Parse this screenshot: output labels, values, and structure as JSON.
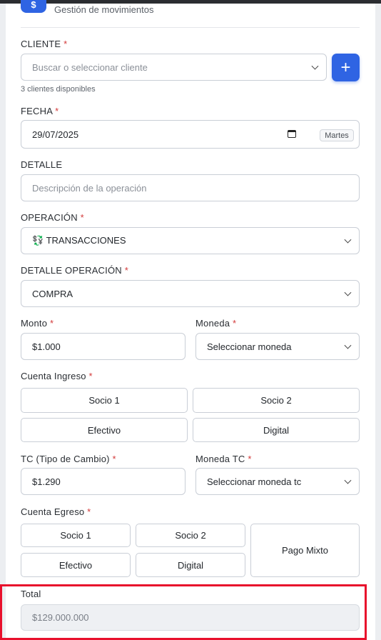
{
  "header": {
    "icon": "dollar-icon",
    "subtitle": "Gestión de movimientos"
  },
  "cliente": {
    "label": "CLIENTE",
    "required": "*",
    "placeholder": "Buscar o seleccionar cliente",
    "hint": "3 clientes disponibles",
    "add_icon": "+"
  },
  "fecha": {
    "label": "FECHA",
    "required": "*",
    "value": "29/07/2025",
    "day": "Martes"
  },
  "detalle": {
    "label": "DETALLE",
    "placeholder": "Descripción de la operación"
  },
  "operacion": {
    "label": "OPERACIÓN",
    "required": "*",
    "value": "💱 TRANSACCIONES"
  },
  "detalle_operacion": {
    "label": "DETALLE OPERACIÓN",
    "required": "*",
    "value": "COMPRA"
  },
  "monto": {
    "label": "Monto",
    "required": "*",
    "value": "$1.000"
  },
  "moneda": {
    "label": "Moneda",
    "required": "*",
    "value": "Seleccionar moneda"
  },
  "cuenta_ingreso": {
    "label": "Cuenta Ingreso",
    "required": "*",
    "options": [
      "Socio 1",
      "Socio 2",
      "Efectivo",
      "Digital"
    ]
  },
  "tc": {
    "label": "TC (Tipo de Cambio)",
    "required": "*",
    "value": "$1.290"
  },
  "moneda_tc": {
    "label": "Moneda TC",
    "required": "*",
    "value": "Seleccionar moneda tc"
  },
  "cuenta_egreso": {
    "label": "Cuenta Egreso",
    "required": "*",
    "options": [
      "Socio 1",
      "Socio 2",
      "Efectivo",
      "Digital"
    ],
    "mixed": "Pago Mixto"
  },
  "total": {
    "label": "Total",
    "value": "$129.000.000"
  },
  "colors": {
    "accent": "#2f64e3",
    "required": "#d33a3a",
    "highlight": "#e8102c"
  }
}
